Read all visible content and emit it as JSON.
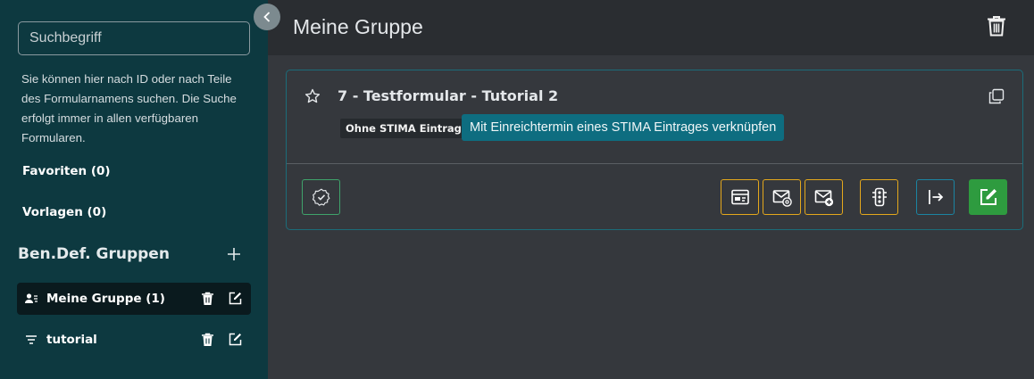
{
  "sidebar": {
    "search_placeholder": "Suchbegriff",
    "help_text": "Sie können hier nach ID oder nach Teile des Formularnamens suchen. Die Suche erfolgt immer in allen verfügbaren Formularen.",
    "favorites_label": "Favoriten (0)",
    "templates_label": "Vorlagen (0)",
    "groups_heading": "Ben.Def. Gruppen",
    "groups": [
      {
        "label": "Meine Gruppe (1)",
        "icon": "user-group-icon",
        "active": true
      },
      {
        "label": "tutorial",
        "icon": "filter-icon",
        "active": false
      }
    ]
  },
  "header": {
    "title": "Meine Gruppe"
  },
  "card": {
    "title": "7 - Testformular - Tutorial 2",
    "badge": "Ohne STIMA Eintrag",
    "link_button": "Mit Einreichtermin eines STIMA Eintrages verknüpfen"
  },
  "colors": {
    "sidebar_bg": "#0d3940",
    "main_bg": "#35383d",
    "header_bg": "#2a2d31",
    "card_border": "#1b6c7a",
    "accent_teal": "#0e6d80",
    "green": "#2e9b3f",
    "yellow": "#e4a81c"
  }
}
